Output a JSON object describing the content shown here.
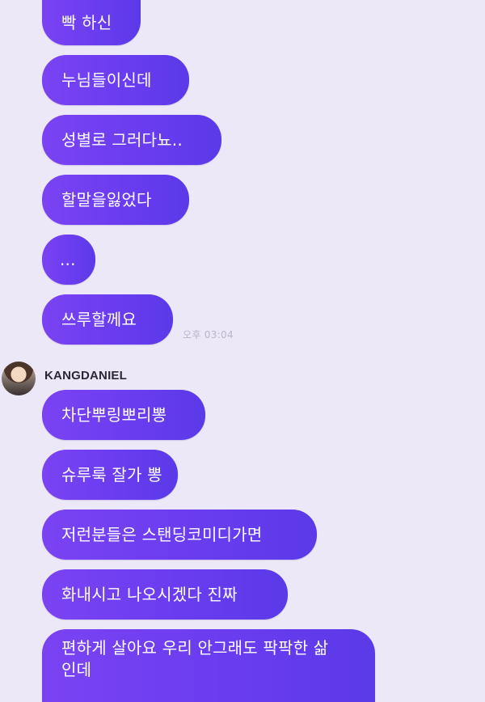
{
  "colors": {
    "background": "#ece8f8",
    "bubble_start": "#7a43f2",
    "bubble_end": "#5b3ae8",
    "bubble_text": "#ffffff",
    "timestamp": "#b9b4c7"
  },
  "chat": {
    "group1": {
      "messages": [
        "빡 하신",
        "누님들이신데",
        "성별로 그러다뇨..",
        "할말을잃었다",
        "...",
        "쓰루할께요"
      ],
      "timestamp": "오후 03:04"
    },
    "group2": {
      "sender": "KANGDANIEL",
      "avatar_icon": "profile-photo-avatar",
      "messages": [
        "차단뿌링뽀리뽕",
        "슈루룩 잘가 뽕",
        "저런분들은 스탠딩코미디가면",
        "화내시고 나오시겠다 진짜",
        "편하게 살아요 우리 안그래도 팍팍한 삶인데"
      ]
    }
  }
}
